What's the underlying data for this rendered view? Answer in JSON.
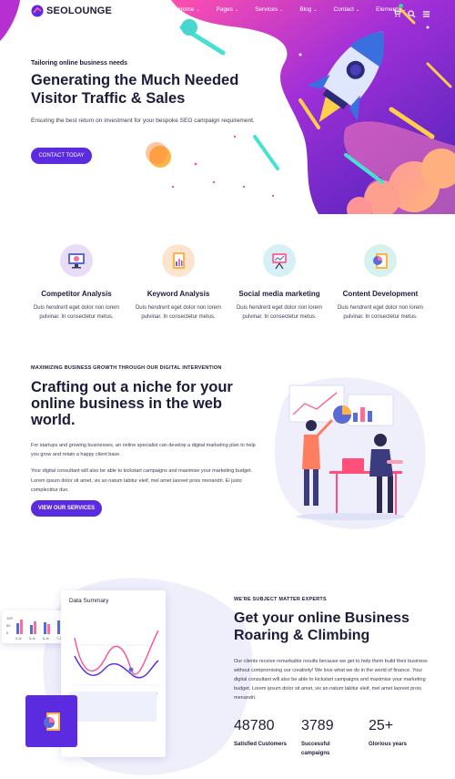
{
  "brand": {
    "logo_text": "SEOLOUNGE",
    "accent": "#5b2be0",
    "hero_gradient": [
      "#ff3ea5",
      "#7a2cd6",
      "#3a1fa8"
    ]
  },
  "nav": {
    "items": [
      {
        "label": "Home"
      },
      {
        "label": "Pages"
      },
      {
        "label": "Services"
      },
      {
        "label": "Blog"
      },
      {
        "label": "Contact"
      },
      {
        "label": "Elements"
      }
    ],
    "icons": [
      "cart-icon",
      "search-icon",
      "menu-icon"
    ]
  },
  "hero": {
    "kicker": "Tailoring online business needs",
    "title": "Generating the Much Needed Visitor Traffic & Sales",
    "text": "Ensuring the best return on investment for your bespoke SEO campaign requirement.",
    "button": "CONTACT TODAY"
  },
  "features": [
    {
      "title": "Competitor Analysis",
      "text": "Duis hendrerit eget dolor non lorem pulvinar. In consectetur metus.",
      "icon": "monitor-chart-icon",
      "color": "#e9dcf7"
    },
    {
      "title": "Keyword Analysis",
      "text": "Duis hendrerit eget dolor non lorem pulvinar. In consectetur metus.",
      "icon": "document-chart-icon",
      "color": "#fde4cf"
    },
    {
      "title": "Social media marketing",
      "text": "Duis hendrerit eget dolor non lorem pulvinar. In consectetur metus.",
      "icon": "presentation-board-icon",
      "color": "#d7f0f6"
    },
    {
      "title": "Content Development",
      "text": "Duis hendrerit eget dolor non lorem pulvinar. In consectetur metus.",
      "icon": "pie-report-icon",
      "color": "#d6f2ef"
    }
  ],
  "section2": {
    "kicker": "MAXIMIZING BUSINESS GROWTH THROUGH OUR DIGITAL INTERVENTION",
    "title": "Crafting out a niche for your online business in the web world.",
    "p1": "For startups and growing businesses, an online specialist can develop a digital marketing plan to help you grow and retain a happy client base.",
    "p2": "Your digital consultant will also be able to kickstart campaigns and maximise your marketing budget. Lorem ipsum dolor sit amet, vix an natum labitur eleif, mel amet laoreet prois menandri. Ei justo complectitur duo.",
    "button": "VIEW OUR SERVICES"
  },
  "dashboard": {
    "title": "Data Summary",
    "months": [
      "Jan",
      "Feb",
      "Mar",
      "Apr",
      "May",
      "Jun",
      "July"
    ],
    "mini_labels": [
      "100",
      "50",
      "0"
    ],
    "mini_x": [
      "4-Jx",
      "5-Jx",
      "6-Jx",
      "7-Jx",
      "8-Jx",
      "9-Jx"
    ]
  },
  "section3": {
    "kicker": "WE'RE SUBJECT MATTER EXPERTS",
    "title": "Get your online Business Roaring & Climbing",
    "text": "Our clients receive remarkable results because we get to help them build their business without compromising our creativity! We love what we do in the world of finance. Your digital consultant will also be able to kickstart campaigns and maximise your marketing budget. Lorem ipsum dolor sit amet, vix an natum labitur eleif, mel amet laoreet prois menandri.",
    "stats": [
      {
        "value": "48780",
        "label": "Satisfied Customers"
      },
      {
        "value": "3789",
        "label": "Successful campaigns"
      },
      {
        "value": "25+",
        "label": "Glorious years"
      }
    ]
  }
}
